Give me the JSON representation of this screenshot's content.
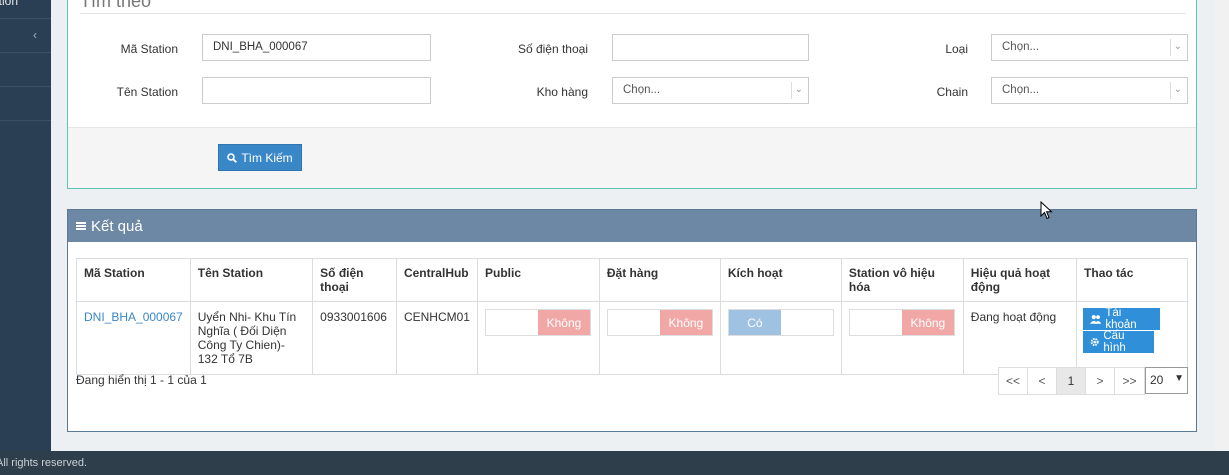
{
  "sidebar": {
    "first_item": "ation",
    "chevron": "‹"
  },
  "search": {
    "legend": "Tìm theo",
    "ma_station_label": "Mã Station",
    "ma_station_value": "DNI_BHA_000067",
    "ten_station_label": "Tên Station",
    "ten_station_value": "",
    "sdt_label": "Số điện thoại",
    "sdt_value": "",
    "kho_hang_label": "Kho hàng",
    "kho_hang_value": "Chọn...",
    "loai_label": "Loại",
    "loai_value": "Chọn...",
    "chain_label": "Chain",
    "chain_value": "Chọn...",
    "search_button": "Tìm Kiếm"
  },
  "result": {
    "title": "Kết quả",
    "columns": [
      "Mã Station",
      "Tên Station",
      "Số điện thoại",
      "CentralHub",
      "Public",
      "Đặt hàng",
      "Kích hoạt",
      "Station vô hiệu hóa",
      "Hiệu quả hoạt động",
      "Thao tác"
    ],
    "rows": [
      {
        "ma_station": "DNI_BHA_000067",
        "ten_station": "Uyển Nhi- Khu Tín Nghĩa ( Đối Diện Công Ty Chien)- 132 Tổ 7B",
        "sdt": "0933001606",
        "central_hub": "CENHCM01",
        "public": "Không",
        "dat_hang": "Không",
        "kich_hoat": "Có",
        "vo_hieu_hoa": "Không",
        "hieu_qua": "Đang hoạt động",
        "btn_account": "Tài khoản",
        "btn_config": "Cấu hình"
      }
    ],
    "showing": "Đang hiển thị 1 - 1 của 1",
    "pager": [
      "<<",
      "<",
      "1",
      ">",
      ">>"
    ],
    "page_size": "20"
  },
  "footer": {
    "text": "All rights reserved."
  },
  "colors": {
    "sidebar": "#2a3f54",
    "accent": "#3a87c8",
    "toggle_off": "#f2a7a7",
    "toggle_on": "#9fc1e2",
    "panel_head": "#6d88a5"
  }
}
